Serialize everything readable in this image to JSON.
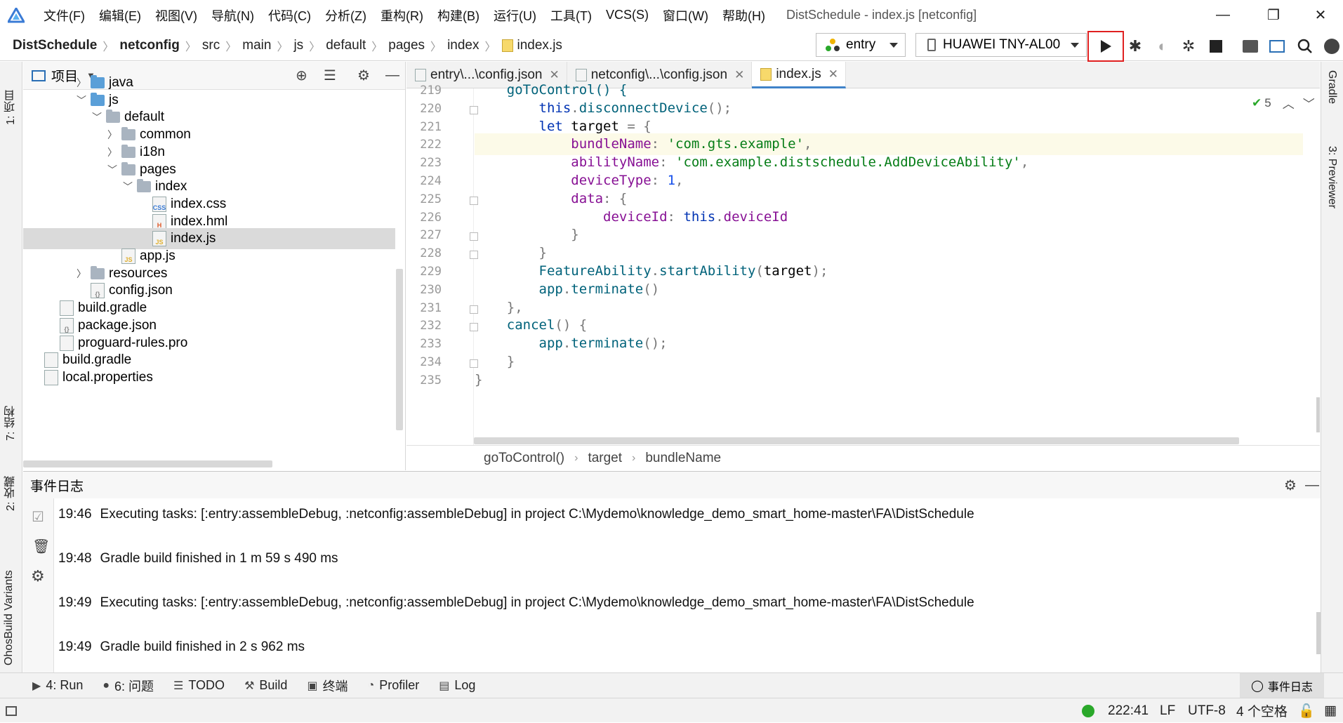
{
  "menu": [
    "文件(F)",
    "编辑(E)",
    "视图(V)",
    "导航(N)",
    "代码(C)",
    "分析(Z)",
    "重构(R)",
    "构建(B)",
    "运行(U)",
    "工具(T)",
    "VCS(S)",
    "窗口(W)",
    "帮助(H)"
  ],
  "window_title": "DistSchedule - index.js [netconfig]",
  "breadcrumbs": [
    "DistSchedule",
    "netconfig",
    "src",
    "main",
    "js",
    "default",
    "pages",
    "index",
    "index.js"
  ],
  "run_config": "entry",
  "device": "HUAWEI TNY-AL00",
  "left_strip": {
    "project": "1: 项目",
    "structure": "7: 结构",
    "favorites": "2: 收藏",
    "build_variants": "OhosBuild Variants"
  },
  "right_strip": {
    "gradle": "Gradle",
    "previewer": "3: Previewer"
  },
  "project_panel": {
    "title": "项目",
    "tree": [
      {
        "label": "java",
        "depth": 4,
        "type": "folder-blue",
        "chevron": "right"
      },
      {
        "label": "js",
        "depth": 4,
        "type": "folder-blue",
        "chevron": "down"
      },
      {
        "label": "default",
        "depth": 5,
        "type": "folder",
        "chevron": "down"
      },
      {
        "label": "common",
        "depth": 6,
        "type": "folder",
        "chevron": "right"
      },
      {
        "label": "i18n",
        "depth": 6,
        "type": "folder",
        "chevron": "right"
      },
      {
        "label": "pages",
        "depth": 6,
        "type": "folder",
        "chevron": "down"
      },
      {
        "label": "index",
        "depth": 7,
        "type": "folder",
        "chevron": "down"
      },
      {
        "label": "index.css",
        "depth": 8,
        "type": "css"
      },
      {
        "label": "index.hml",
        "depth": 8,
        "type": "hml"
      },
      {
        "label": "index.js",
        "depth": 8,
        "type": "js",
        "selected": true
      },
      {
        "label": "app.js",
        "depth": 6,
        "type": "js"
      },
      {
        "label": "resources",
        "depth": 4,
        "type": "folder",
        "chevron": "right"
      },
      {
        "label": "config.json",
        "depth": 4,
        "type": "json"
      },
      {
        "label": "build.gradle",
        "depth": 2,
        "type": "gradle"
      },
      {
        "label": "package.json",
        "depth": 2,
        "type": "json"
      },
      {
        "label": "proguard-rules.pro",
        "depth": 2,
        "type": "file"
      },
      {
        "label": "build.gradle",
        "depth": 1,
        "type": "gradle"
      },
      {
        "label": "local.properties",
        "depth": 1,
        "type": "file"
      }
    ]
  },
  "tabs": [
    {
      "label": "entry\\...\\config.json",
      "active": false
    },
    {
      "label": "netconfig\\...\\config.json",
      "active": false
    },
    {
      "label": "index.js",
      "active": true
    }
  ],
  "inspection_count": "5",
  "code_lines": [
    {
      "n": "219",
      "partial": true,
      "tokens": [
        [
          "fn",
          "    goToControl() {"
        ]
      ]
    },
    {
      "n": "220",
      "tokens": [
        [
          "kw",
          "        this"
        ],
        [
          "pu",
          "."
        ],
        [
          "fn",
          "disconnectDevice"
        ],
        [
          "pu",
          "();"
        ]
      ]
    },
    {
      "n": "221",
      "tokens": [
        [
          "kw",
          "        let "
        ],
        [
          "",
          "target "
        ],
        [
          "pu",
          "= {"
        ]
      ]
    },
    {
      "n": "222",
      "hl": true,
      "tokens": [
        [
          "pr",
          "            bundleName"
        ],
        [
          "pu",
          ": "
        ],
        [
          "st",
          "'com.gts.example'"
        ],
        [
          "pu",
          ","
        ]
      ]
    },
    {
      "n": "223",
      "tokens": [
        [
          "pr",
          "            abilityName"
        ],
        [
          "pu",
          ": "
        ],
        [
          "st",
          "'com.example.distschedule.AddDeviceAbility'"
        ],
        [
          "pu",
          ","
        ]
      ]
    },
    {
      "n": "224",
      "tokens": [
        [
          "pr",
          "            deviceType"
        ],
        [
          "pu",
          ": "
        ],
        [
          "nm",
          "1"
        ],
        [
          "pu",
          ","
        ]
      ]
    },
    {
      "n": "225",
      "tokens": [
        [
          "pr",
          "            data"
        ],
        [
          "pu",
          ": {"
        ]
      ]
    },
    {
      "n": "226",
      "tokens": [
        [
          "pr",
          "                deviceId"
        ],
        [
          "pu",
          ": "
        ],
        [
          "kw",
          "this"
        ],
        [
          "pu",
          "."
        ],
        [
          "pr",
          "deviceId"
        ]
      ]
    },
    {
      "n": "227",
      "tokens": [
        [
          "pu",
          "            }"
        ]
      ]
    },
    {
      "n": "228",
      "tokens": [
        [
          "pu",
          "        }"
        ]
      ]
    },
    {
      "n": "229",
      "tokens": [
        [
          "fn",
          "        FeatureAbility"
        ],
        [
          "pu",
          "."
        ],
        [
          "fn",
          "startAbility"
        ],
        [
          "pu",
          "("
        ],
        [
          "",
          "target"
        ],
        [
          "pu",
          ");"
        ]
      ]
    },
    {
      "n": "230",
      "tokens": [
        [
          "fn",
          "        app"
        ],
        [
          "pu",
          "."
        ],
        [
          "fn",
          "terminate"
        ],
        [
          "pu",
          "()"
        ]
      ]
    },
    {
      "n": "231",
      "tokens": [
        [
          "pu",
          "    },"
        ]
      ]
    },
    {
      "n": "232",
      "tokens": [
        [
          "fn",
          "    cancel"
        ],
        [
          "pu",
          "() {"
        ]
      ]
    },
    {
      "n": "233",
      "tokens": [
        [
          "fn",
          "        app"
        ],
        [
          "pu",
          "."
        ],
        [
          "fn",
          "terminate"
        ],
        [
          "pu",
          "();"
        ]
      ]
    },
    {
      "n": "234",
      "tokens": [
        [
          "pu",
          "    }"
        ]
      ]
    },
    {
      "n": "235",
      "partial": true,
      "tokens": [
        [
          "pu",
          "}"
        ]
      ]
    }
  ],
  "code_breadcrumb": [
    "goToControl()",
    "target",
    "bundleName"
  ],
  "event_log": {
    "title": "事件日志",
    "entries": [
      {
        "time": "19:46",
        "text": "Executing tasks: [:entry:assembleDebug, :netconfig:assembleDebug] in project C:\\Mydemo\\knowledge_demo_smart_home-master\\FA\\DistSchedule"
      },
      {
        "time": "19:48",
        "text": "Gradle build finished in 1 m 59 s 490 ms"
      },
      {
        "time": "19:49",
        "text": "Executing tasks: [:entry:assembleDebug, :netconfig:assembleDebug] in project C:\\Mydemo\\knowledge_demo_smart_home-master\\FA\\DistSchedule"
      },
      {
        "time": "19:49",
        "text": "Gradle build finished in 2 s 962 ms"
      }
    ]
  },
  "bottom_tools": [
    {
      "label": "4: Run",
      "icon": "run-icon"
    },
    {
      "label": "6: 问题",
      "icon": "problems-icon"
    },
    {
      "label": "TODO",
      "icon": "todo-icon"
    },
    {
      "label": "Build",
      "icon": "build-icon"
    },
    {
      "label": "终端",
      "icon": "terminal-icon"
    },
    {
      "label": "Profiler",
      "icon": "profiler-icon"
    },
    {
      "label": "Log",
      "icon": "log-icon"
    }
  ],
  "event_log_button": "事件日志",
  "status": {
    "position": "222:41",
    "line_sep": "LF",
    "encoding": "UTF-8",
    "indent": "4 个空格"
  },
  "colors": {
    "accent": "#4083c9",
    "run_highlight": "#e02020",
    "ok_green": "#2aa82a"
  }
}
